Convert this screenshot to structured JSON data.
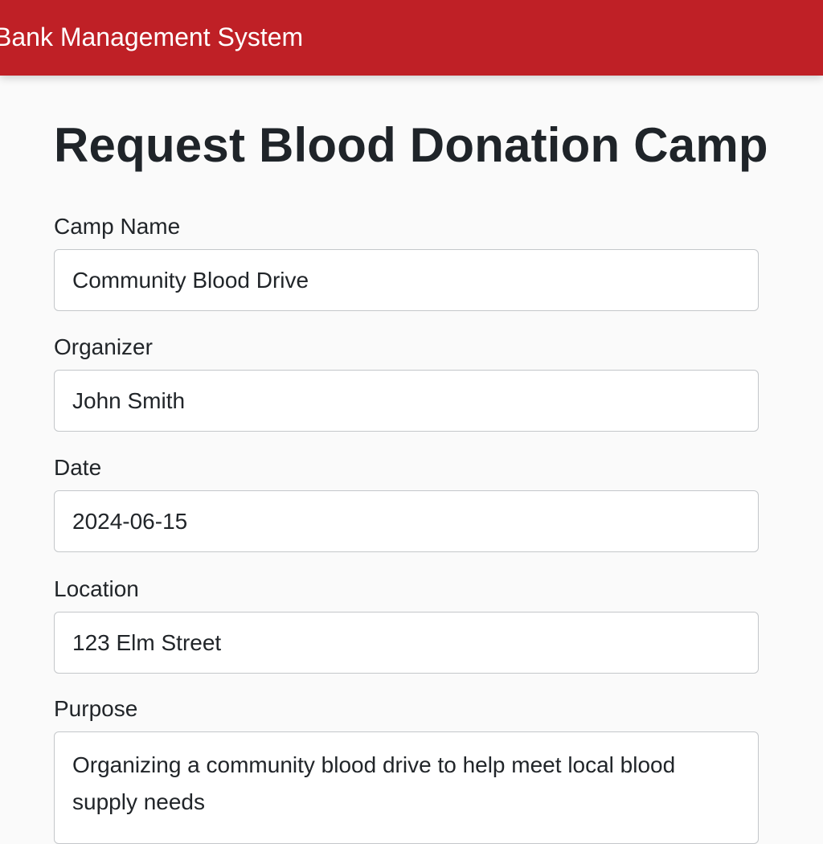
{
  "navbar": {
    "brand": "Bank Management System",
    "background_color": "#bf2026"
  },
  "page": {
    "title": "Request Blood Donation Camp"
  },
  "form": {
    "camp_name": {
      "label": "Camp Name",
      "value": "Community Blood Drive"
    },
    "organizer": {
      "label": "Organizer",
      "value": "John Smith"
    },
    "date": {
      "label": "Date",
      "value": "2024-06-15"
    },
    "location": {
      "label": "Location",
      "value": "123 Elm Street"
    },
    "purpose": {
      "label": "Purpose",
      "value": "Organizing a community blood drive to help meet local blood supply needs"
    }
  }
}
